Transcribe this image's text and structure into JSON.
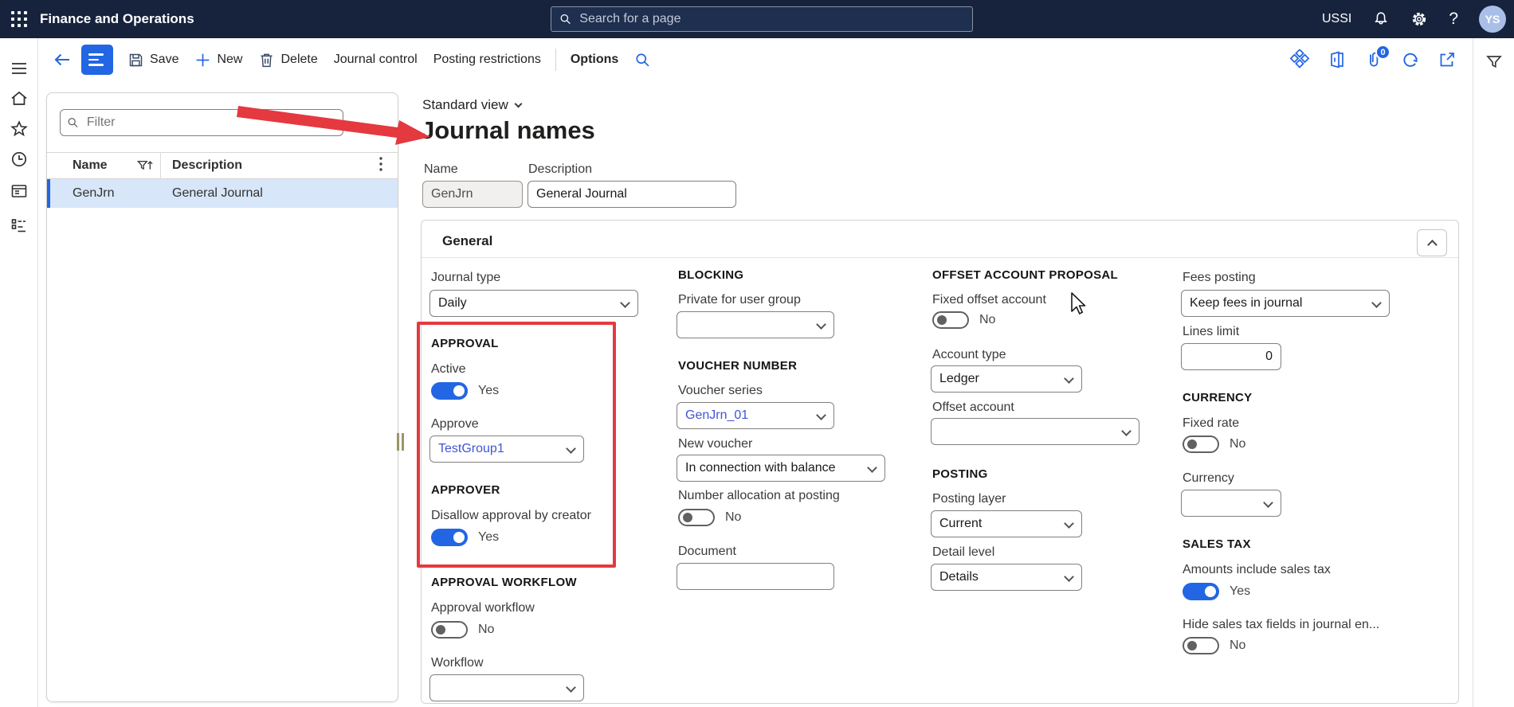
{
  "topbar": {
    "app_title": "Finance and Operations",
    "search_placeholder": "Search for a page",
    "environment": "USSI",
    "help_label": "?",
    "avatar_initials": "YS"
  },
  "action_bar": {
    "save": "Save",
    "new": "New",
    "delete": "Delete",
    "journal_control": "Journal control",
    "posting_restrictions": "Posting restrictions",
    "options": "Options",
    "attachments_badge": "0"
  },
  "left_panel": {
    "filter_placeholder": "Filter",
    "columns": [
      "Name",
      "Description"
    ],
    "rows": [
      {
        "name": "GenJrn",
        "description": "General Journal"
      }
    ]
  },
  "page": {
    "view_selector": "Standard view",
    "title": "Journal names",
    "name_label": "Name",
    "name_value": "GenJrn",
    "description_label": "Description",
    "description_value": "General Journal"
  },
  "general": {
    "header": "General",
    "journal_type": {
      "label": "Journal type",
      "value": "Daily"
    },
    "approval_section": "APPROVAL",
    "active": {
      "label": "Active",
      "state": "Yes"
    },
    "approve": {
      "label": "Approve",
      "value": "TestGroup1"
    },
    "approver_section": "APPROVER",
    "disallow": {
      "label": "Disallow approval by creator",
      "state": "Yes"
    },
    "approval_workflow_section": "APPROVAL WORKFLOW",
    "approval_workflow": {
      "label": "Approval workflow",
      "state": "No"
    },
    "workflow": {
      "label": "Workflow",
      "value": ""
    },
    "blocking_section": "BLOCKING",
    "private_group": {
      "label": "Private for user group",
      "value": ""
    },
    "voucher_section": "VOUCHER NUMBER",
    "voucher_series": {
      "label": "Voucher series",
      "value": "GenJrn_01"
    },
    "new_voucher": {
      "label": "New voucher",
      "value": "In connection with balance"
    },
    "number_allocation": {
      "label": "Number allocation at posting",
      "state": "No"
    },
    "document": {
      "label": "Document",
      "value": ""
    },
    "offset_section": "OFFSET ACCOUNT PROPOSAL",
    "fixed_offset": {
      "label": "Fixed offset account",
      "state": "No"
    },
    "account_type": {
      "label": "Account type",
      "value": "Ledger"
    },
    "offset_account": {
      "label": "Offset account",
      "value": ""
    },
    "posting_section": "POSTING",
    "posting_layer": {
      "label": "Posting layer",
      "value": "Current"
    },
    "detail_level": {
      "label": "Detail level",
      "value": "Details"
    },
    "fees_posting": {
      "label": "Fees posting",
      "value": "Keep fees in journal"
    },
    "lines_limit": {
      "label": "Lines limit",
      "value": "0"
    },
    "currency_section": "CURRENCY",
    "fixed_rate": {
      "label": "Fixed rate",
      "state": "No"
    },
    "currency": {
      "label": "Currency",
      "value": ""
    },
    "sales_tax_section": "SALES TAX",
    "amounts_include": {
      "label": "Amounts include sales tax",
      "state": "Yes"
    },
    "hide_sales_tax": {
      "label": "Hide sales tax fields in journal en...",
      "state": "No"
    }
  },
  "colors": {
    "accent": "#2266e3",
    "topbar_background": "#17233d",
    "selected_row": "#d7e6f9",
    "lookup_link": "#4155d4",
    "annotation_red": "#e4393f"
  }
}
